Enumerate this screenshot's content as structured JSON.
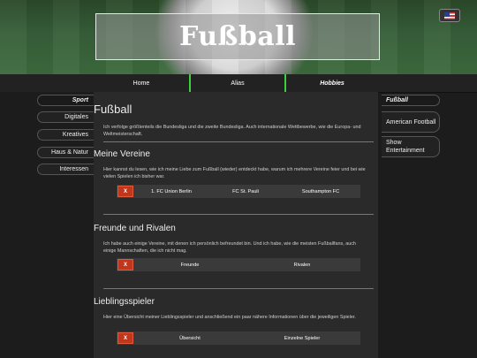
{
  "header": {
    "title": "Fußball",
    "language": "English"
  },
  "nav": {
    "items": [
      {
        "label": "Home"
      },
      {
        "label": "Alias"
      },
      {
        "label": "Hobbies"
      }
    ]
  },
  "left_nav": {
    "items": [
      {
        "label": "Sport"
      },
      {
        "label": "Digitales"
      },
      {
        "label": "Kreatives"
      },
      {
        "label": "Haus & Natur"
      },
      {
        "label": "Interessen"
      }
    ]
  },
  "right_nav": {
    "items": [
      {
        "label": "Fußball"
      },
      {
        "label": "American Football"
      },
      {
        "label": "Show Entertainment"
      }
    ]
  },
  "main": {
    "title": "Fußball",
    "intro": "Ich verfolge größtenteils die Bundesliga und die zweite Bundesliga. Auch internationale Wettbewerbe, wie die Europa- und Weltmeisterschaft.",
    "sections": [
      {
        "title": "Meine Vereine",
        "text": "Hier kannst du lesen, wie ich meine Liebe zum Fußball (wieder) entdeckt habe, warum ich mehrere Vereine feier und bei wie vielen Spielen ich bisher war.",
        "close": "X",
        "tabs": [
          "1. FC Union Berlin",
          "FC St. Pauli",
          "Southampton FC"
        ]
      },
      {
        "title": "Freunde und Rivalen",
        "text": "Ich habe auch einige Vereine, mit denen ich persönlich befreundet bin. Und ich habe, wie die meisten Fußballfans, auch einige Mannschaften, die ich nicht mag.",
        "close": "X",
        "tabs": [
          "Freunde",
          "Rivalen"
        ]
      },
      {
        "title": "Lieblingsspieler",
        "text": "Hier eine Übersicht meiner Lieblingsspieler und anschließend ein paar nähere Informationen über die jeweiligen Spieler.",
        "close": "X",
        "tabs": [
          "Übersicht",
          "Einzelne Spieler"
        ]
      }
    ]
  }
}
